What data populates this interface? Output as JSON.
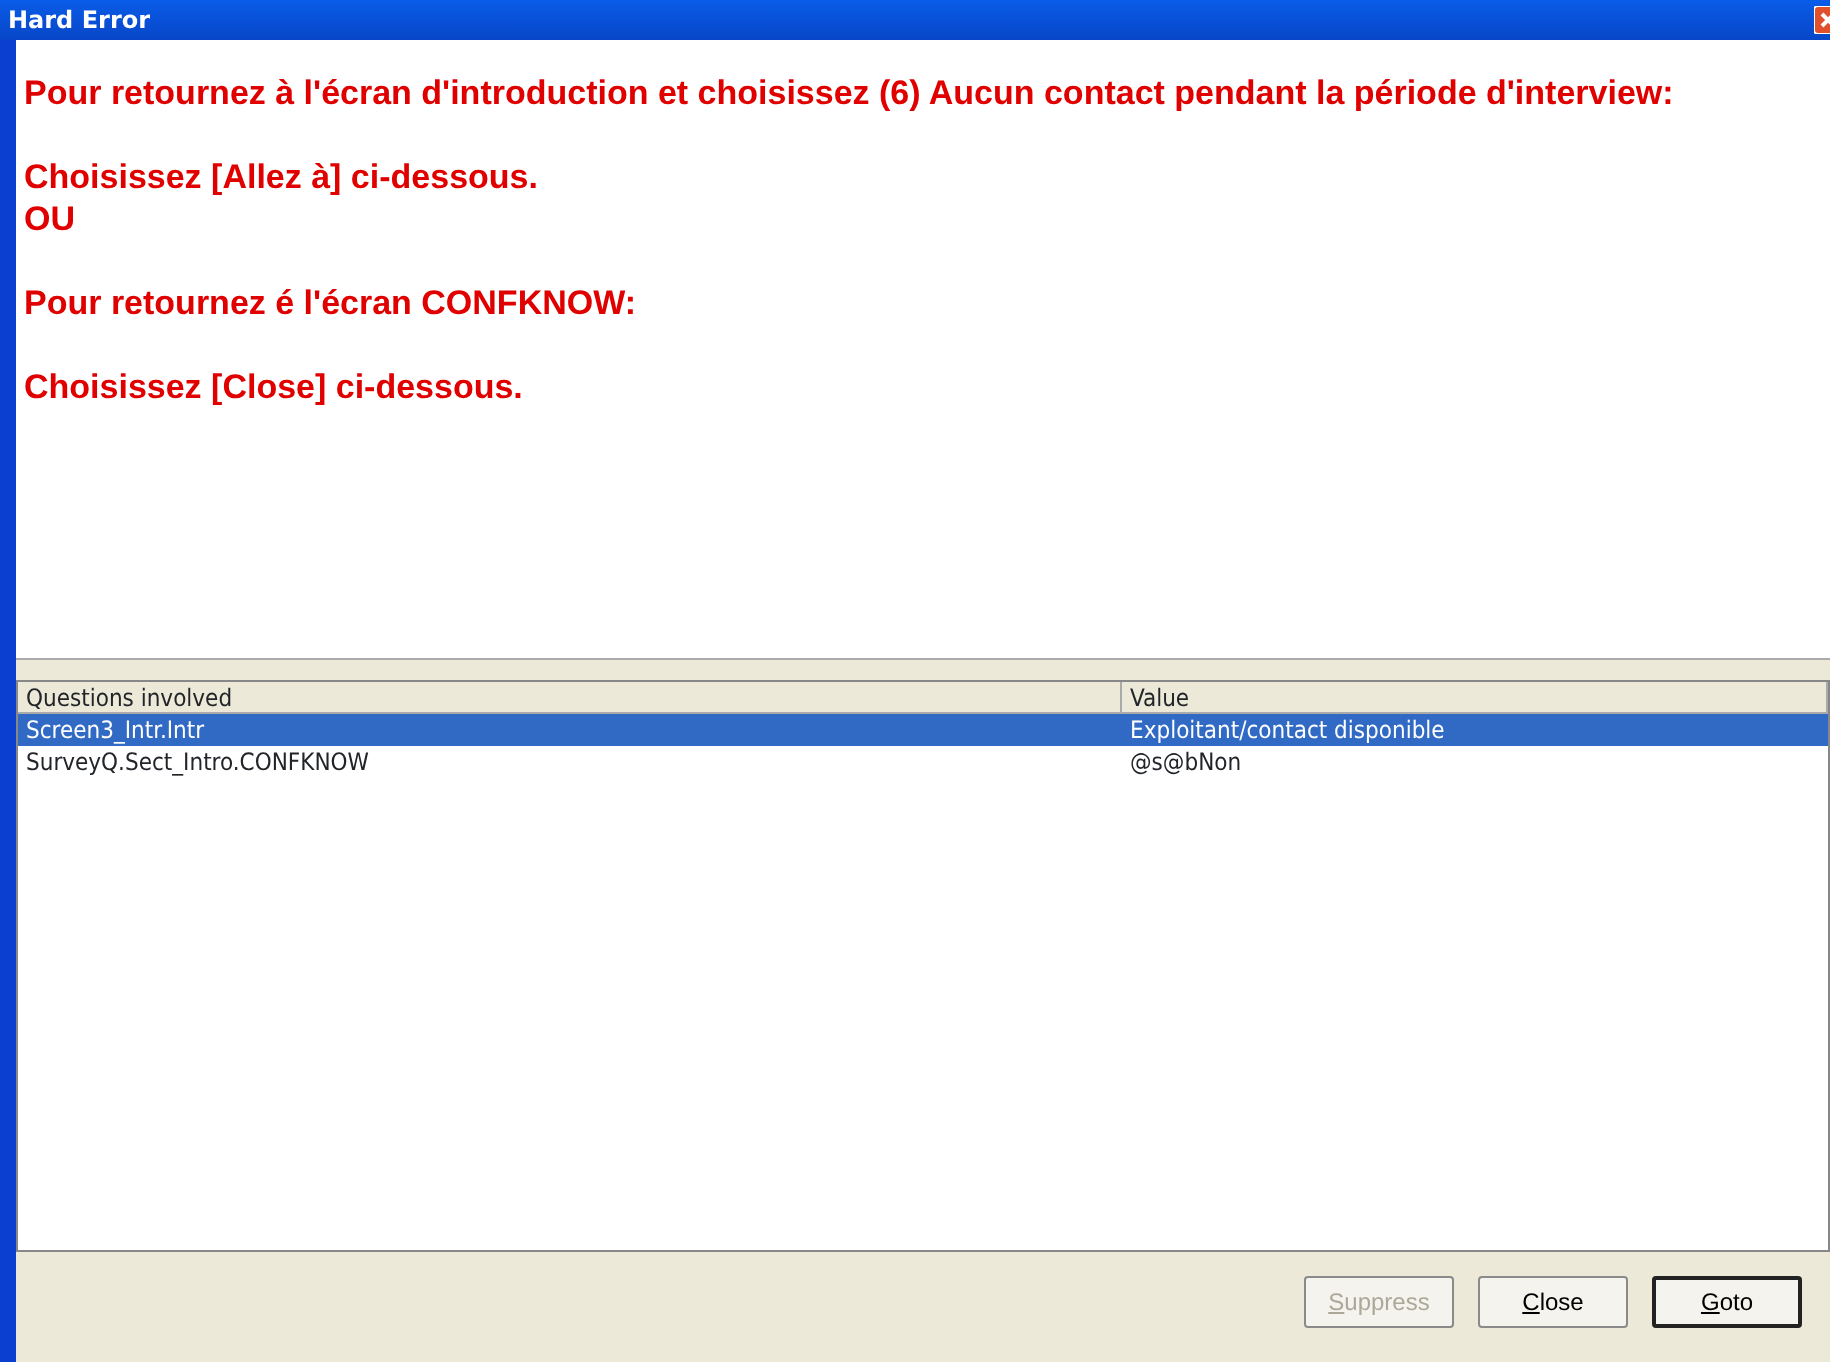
{
  "window": {
    "title": "Hard Error"
  },
  "message": [
    [
      "Pour retournez à l'écran d'introduction et choisissez (6) Aucun contact pendant la période d'interview:"
    ],
    [
      "Choisissez [Allez à] ci-dessous.",
      "OU"
    ],
    [
      "Pour retournez é l'écran CONFKNOW:"
    ],
    [
      "Choisissez [Close] ci-dessous."
    ]
  ],
  "table": {
    "columns": [
      "Questions involved",
      "Value"
    ],
    "rows": [
      {
        "cells": [
          "Screen3_Intr.Intr",
          "Exploitant/contact disponible"
        ],
        "selected": true
      },
      {
        "cells": [
          "SurveyQ.Sect_Intro.CONFKNOW",
          "@s@bNon"
        ],
        "selected": false
      }
    ]
  },
  "buttons": [
    {
      "label": "Suppress",
      "disabled": true,
      "default": false
    },
    {
      "label": "Close",
      "disabled": false,
      "default": false
    },
    {
      "label": "Goto",
      "disabled": false,
      "default": true
    }
  ]
}
